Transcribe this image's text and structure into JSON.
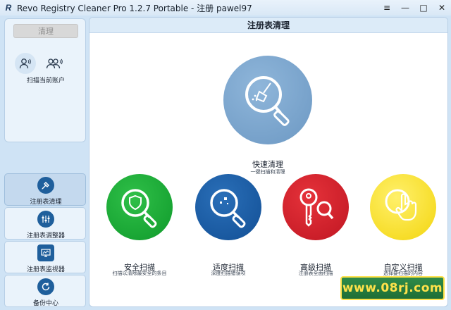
{
  "window": {
    "title": "Revo Registry Cleaner Pro 1.2.7 Portable - 注册 pawel97",
    "logo_text": "R",
    "controls": {
      "menu": "≡",
      "minimize": "—",
      "maximize": "□",
      "close": "✕"
    }
  },
  "sidebar": {
    "clean_button": "清理",
    "accounts_label": "扫描当前账户",
    "nav": [
      {
        "label": "注册表清理",
        "icon": "registry-cleaner-icon",
        "active": true
      },
      {
        "label": "注册表调整器",
        "icon": "registry-tuner-icon",
        "active": false
      },
      {
        "label": "注册表监视器",
        "icon": "registry-monitor-icon",
        "active": false
      },
      {
        "label": "备份中心",
        "icon": "backup-center-icon",
        "active": false
      }
    ]
  },
  "main": {
    "header": "注册表清理",
    "quick": {
      "title": "快速清理",
      "subtitle": "一键扫描和清理"
    },
    "modes": [
      {
        "title": "安全扫描",
        "subtitle": "扫描以清除最安全的条目",
        "color": "#14a832",
        "icon": "shield-magnifier-icon"
      },
      {
        "title": "适度扫描",
        "subtitle": "深度扫描错误项",
        "color": "#1a5ea6",
        "icon": "dots-magnifier-icon"
      },
      {
        "title": "高级扫描",
        "subtitle": "注册表全面扫描",
        "color": "#d4212b",
        "icon": "key-magnifier-icon"
      },
      {
        "title": "自定义扫描",
        "subtitle": "选择要扫描的内容",
        "color": "#f8e02a",
        "icon": "hand-magnifier-icon"
      }
    ]
  },
  "watermark": "www.08rj.com",
  "colors": {
    "accent_blue": "#6c98c3",
    "panel_bg": "#eaf3fb",
    "window_bg": "#cfe3f5"
  }
}
